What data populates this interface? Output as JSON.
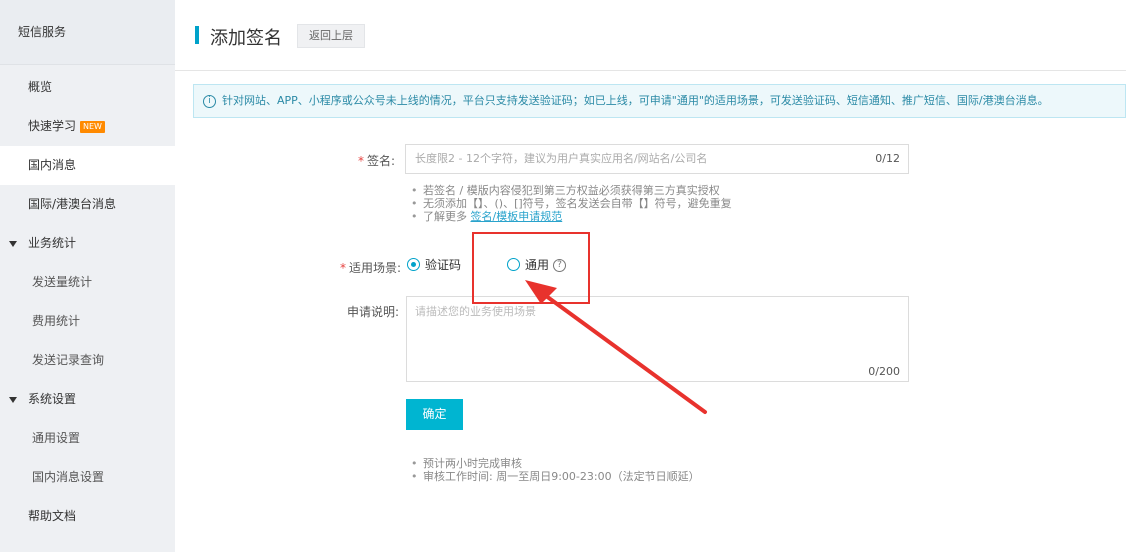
{
  "sidebar": {
    "title": "短信服务",
    "items": [
      {
        "label": "概览",
        "type": "item"
      },
      {
        "label": "快速学习",
        "type": "item",
        "badge": "NEW"
      },
      {
        "label": "国内消息",
        "type": "item",
        "active": true
      },
      {
        "label": "国际/港澳台消息",
        "type": "item"
      },
      {
        "label": "业务统计",
        "type": "group"
      },
      {
        "label": "发送量统计",
        "type": "sub"
      },
      {
        "label": "费用统计",
        "type": "sub"
      },
      {
        "label": "发送记录查询",
        "type": "sub"
      },
      {
        "label": "系统设置",
        "type": "group"
      },
      {
        "label": "通用设置",
        "type": "sub"
      },
      {
        "label": "国内消息设置",
        "type": "sub"
      },
      {
        "label": "帮助文档",
        "type": "item"
      }
    ]
  },
  "header": {
    "title": "添加签名",
    "back_label": "返回上层"
  },
  "info": {
    "text": "针对网站、APP、小程序或公众号未上线的情况，平台只支持发送验证码；如已上线，可申请\"通用\"的适用场景，可发送验证码、短信通知、推广短信、国际/港澳台消息。"
  },
  "form": {
    "sign": {
      "required_mark": "*",
      "label": "签名:",
      "placeholder": "长度限2 - 12个字符，建议为用户真实应用名/网站名/公司名",
      "counter": "0/12"
    },
    "tips": [
      "若签名 / 模版内容侵犯到第三方权益必须获得第三方真实授权",
      "无须添加【】、()、[]符号，签名发送会自带【】符号，避免重复"
    ],
    "tip_more_prefix": "了解更多",
    "tip_more_link": "签名/模板申请规范",
    "scene": {
      "required_mark": "*",
      "label": "适用场景:",
      "options": [
        {
          "label": "验证码",
          "checked": true
        },
        {
          "label": "通用",
          "checked": false
        }
      ],
      "help_symbol": "?"
    },
    "description": {
      "label": "申请说明:",
      "placeholder": "请描述您的业务使用场景",
      "counter": "0/200"
    },
    "confirm_label": "确定",
    "footer_tips": [
      "预计两小时完成审核",
      "审核工作时间: 周一至周日9:00-23:00（法定节日顺延）"
    ]
  },
  "colors": {
    "accent": "#00a2ca",
    "button": "#00b5d1",
    "annotation": "#e8322d",
    "new_badge": "#ff8a00"
  }
}
